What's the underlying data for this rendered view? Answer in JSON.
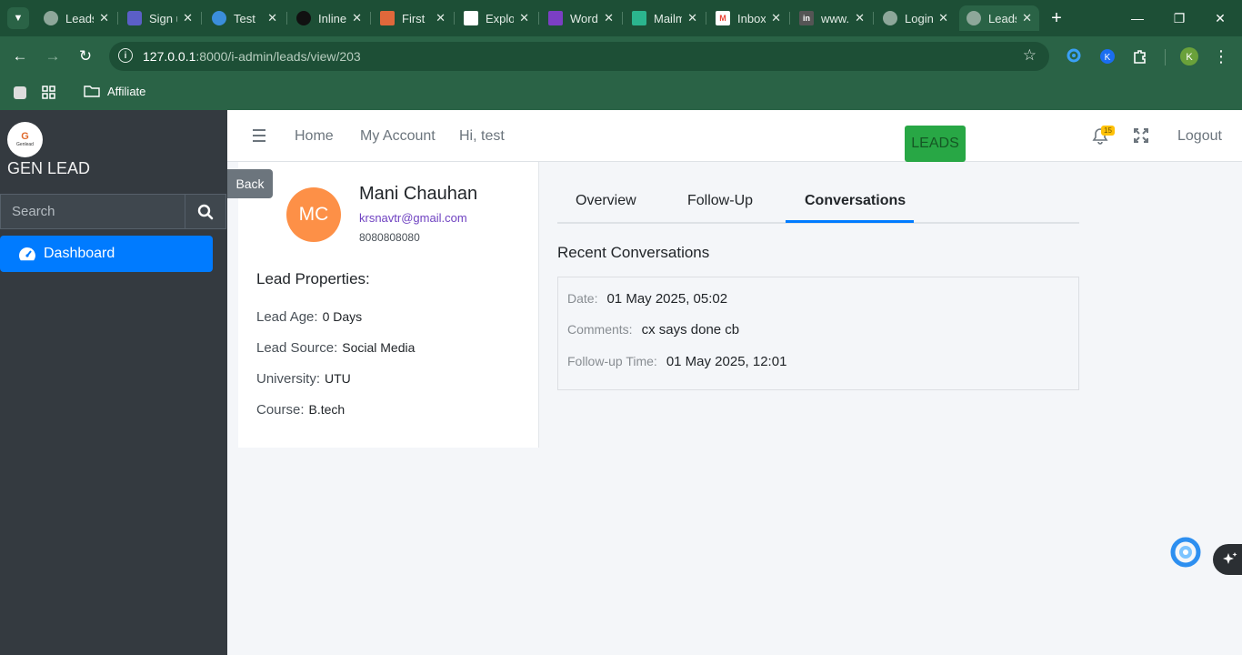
{
  "browser": {
    "tabs": [
      {
        "title": "Leads",
        "color": "#8ea79a"
      },
      {
        "title": "Sign up",
        "color": "#5b5fc7"
      },
      {
        "title": "Test",
        "color": "#3b8edb"
      },
      {
        "title": "Inline",
        "color": "#111111"
      },
      {
        "title": "First",
        "color": "#e0683b"
      },
      {
        "title": "Explore",
        "color": "#ffffff"
      },
      {
        "title": "WordPress",
        "color": "#7b3fc4"
      },
      {
        "title": "Mailmodo",
        "color": "#2bb58e"
      },
      {
        "title": "Inbox",
        "color": "#ea4335"
      },
      {
        "title": "www.linkedin.com",
        "color": "#555555"
      },
      {
        "title": "Login",
        "color": "#8ea79a"
      },
      {
        "title": "Leads",
        "color": "#8ea79a"
      }
    ],
    "url_host": "127.0.0.1",
    "url_rest": ":8000/i-admin/leads/view/203",
    "profile_initial": "K",
    "bookmark_folder": "Affiliate"
  },
  "sidebar": {
    "brand_logo_letter": "G",
    "brand_logo_text": "Genlead",
    "brand_name": "GEN LEAD",
    "search_placeholder": "Search",
    "nav_dashboard": "Dashboard"
  },
  "topnav": {
    "home": "Home",
    "my_account": "My Account",
    "greeting": "Hi, test",
    "leads_button": "LEADS",
    "notification_count": "15",
    "logout": "Logout"
  },
  "profile": {
    "back": "Back",
    "initials": "MC",
    "name": "Mani Chauhan",
    "email": "krsnavtr@gmail.com",
    "phone": "8080808080",
    "properties_title": "Lead Properties:",
    "properties": [
      {
        "label": "Lead Age:",
        "value": "0 Days"
      },
      {
        "label": "Lead Source:",
        "value": "Social Media"
      },
      {
        "label": "University:",
        "value": "UTU"
      },
      {
        "label": "Course:",
        "value": "B.tech"
      }
    ]
  },
  "tabs": {
    "overview": "Overview",
    "follow_up": "Follow-Up",
    "conversations": "Conversations",
    "active": "conversations"
  },
  "conversations": {
    "title": "Recent Conversations",
    "entries": [
      {
        "date_label": "Date:",
        "date": "01 May 2025, 05:02",
        "comments_label": "Comments:",
        "comments": "cx says done cb",
        "followup_label": "Follow-up Time:",
        "followup": "01 May 2025, 12:01"
      }
    ]
  },
  "colors": {
    "sidebar_bg": "#343a40",
    "primary": "#007bff",
    "leads_button": "#28a745",
    "avatar": "#fd9047",
    "browser_frame": "#1d4f36"
  }
}
